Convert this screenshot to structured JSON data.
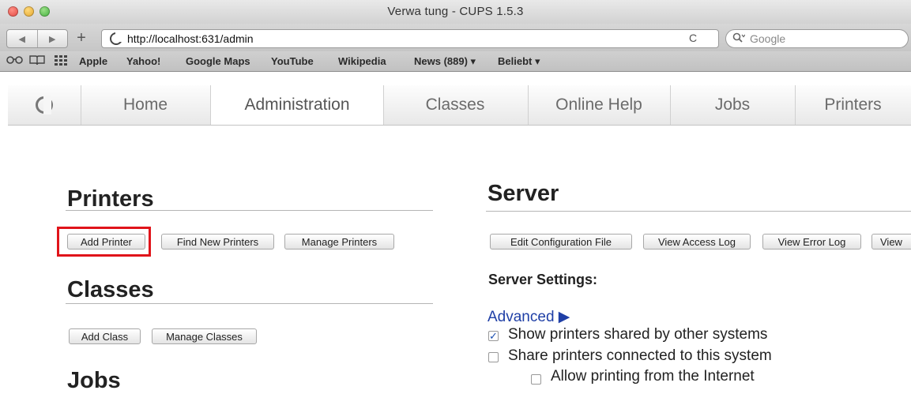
{
  "window": {
    "title": "Verwa tung - CUPS 1.5.3"
  },
  "toolbar": {
    "url": "http://localhost:631/admin",
    "search_placeholder": "Google",
    "back_glyph": "◀",
    "forward_glyph": "▶",
    "new_tab_glyph": "+",
    "reload_glyph": "C"
  },
  "bookmarks": {
    "items": [
      "Apple",
      "Yahoo!",
      "Google Maps",
      "YouTube",
      "Wikipedia",
      "News (889) ▾",
      "Beliebt ▾"
    ]
  },
  "nav": {
    "tabs": [
      "Home",
      "Administration",
      "Classes",
      "Online Help",
      "Jobs",
      "Printers"
    ],
    "active": "Administration"
  },
  "printers": {
    "heading": "Printers",
    "buttons": [
      "Add Printer",
      "Find New Printers",
      "Manage Printers"
    ]
  },
  "classes": {
    "heading": "Classes",
    "buttons": [
      "Add Class",
      "Manage Classes"
    ]
  },
  "jobs": {
    "heading": "Jobs"
  },
  "server": {
    "heading": "Server",
    "buttons": [
      "Edit Configuration File",
      "View Access Log",
      "View Error Log",
      "View"
    ],
    "settings_heading": "Server Settings:",
    "advanced_label": "Advanced ▶",
    "options": [
      {
        "label": "Show printers shared by other systems",
        "checked": true
      },
      {
        "label": "Share printers connected to this system",
        "checked": false
      },
      {
        "label": "Allow printing from the Internet",
        "checked": false
      }
    ]
  },
  "colors": {
    "highlight": "#e0141a",
    "link": "#1f3fa6"
  }
}
